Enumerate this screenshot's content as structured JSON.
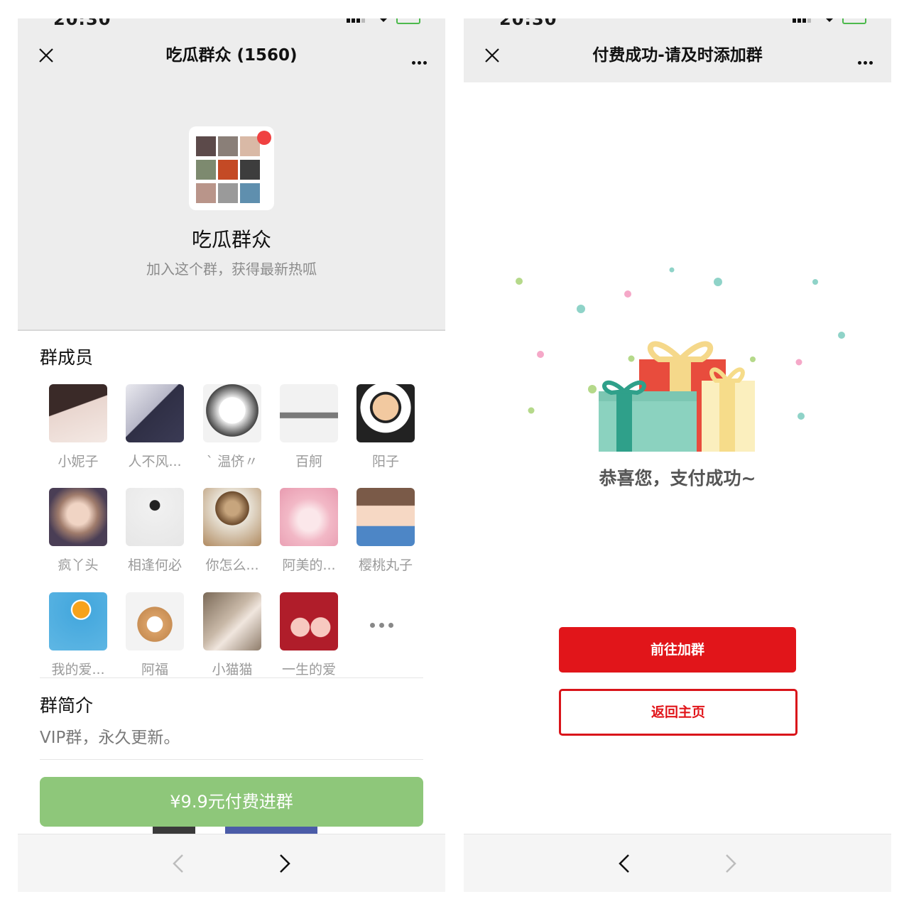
{
  "left": {
    "status_time": "20:30",
    "title": "吃瓜群众 (1560)",
    "group": {
      "name": "吃瓜群众",
      "tagline": "加入这个群，获得最新热呱"
    },
    "members_heading": "群成员",
    "members": [
      {
        "name": "小妮子"
      },
      {
        "name": "人不风..."
      },
      {
        "name": "` 温侪〃"
      },
      {
        "name": "百舸"
      },
      {
        "name": "阳子"
      },
      {
        "name": "疯丫头"
      },
      {
        "name": "相逢何必"
      },
      {
        "name": "你怎么..."
      },
      {
        "name": "阿美的..."
      },
      {
        "name": "樱桃丸子"
      },
      {
        "name": "我的爱..."
      },
      {
        "name": "阿福"
      },
      {
        "name": "小猫猫"
      },
      {
        "name": "一生的爱"
      }
    ],
    "intro_heading": "群简介",
    "intro_text": "VIP群，永久更新。",
    "pay_button": "¥9.9元付费进群",
    "colors": {
      "pay_button": "#8ec77a",
      "badge": "#f04141"
    }
  },
  "right": {
    "status_time": "20:30",
    "title": "付费成功-请及时添加群",
    "success_message": "恭喜您，支付成功~",
    "primary_button": "前往加群",
    "secondary_button": "返回主页",
    "colors": {
      "accent": "#e1151a"
    }
  },
  "icons": [
    "close-icon",
    "more-icon",
    "back-arrow-icon",
    "forward-arrow-icon",
    "gift-illustration"
  ]
}
